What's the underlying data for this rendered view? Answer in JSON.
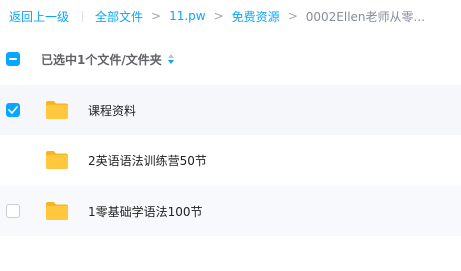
{
  "breadcrumb": {
    "back": "返回上一级",
    "items": [
      "全部文件",
      "11.pw",
      "免费资源"
    ],
    "separator": ">",
    "current": "0002Ellen老师从零..."
  },
  "header": {
    "selection_text": "已选中1个文件/文件夹",
    "select_all_state": "partial"
  },
  "files": [
    {
      "name": "课程资料",
      "checked": true
    },
    {
      "name": "2英语语法训练营50节",
      "checked": false
    },
    {
      "name": "1零基础学语法100节",
      "checked": false
    }
  ],
  "icons": {
    "folder": "folder-icon",
    "check": "check-icon",
    "sort": "sort-icon"
  },
  "colors": {
    "accent": "#06a7ff",
    "folder": "#ffc83d",
    "folder_tab": "#f5b623",
    "selected_row": "#f5f7fb"
  }
}
